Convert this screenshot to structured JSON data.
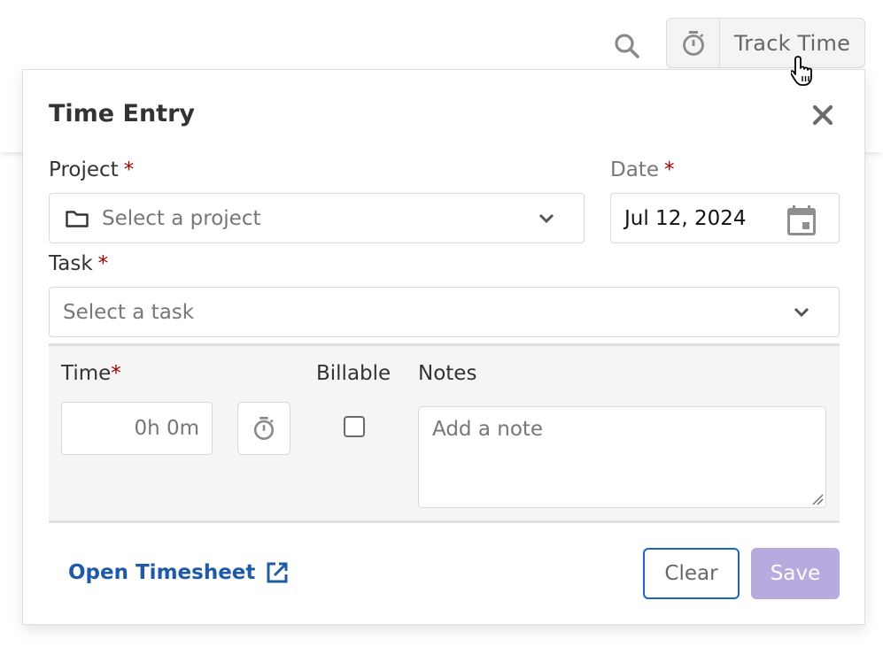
{
  "header": {
    "search_icon": "search-icon",
    "track_time": {
      "icon": "stopwatch-icon",
      "label": "Track Time"
    }
  },
  "popover": {
    "title": "Time Entry",
    "close_icon": "close-icon",
    "project": {
      "label": "Project",
      "required_mark": "*",
      "icon": "folder-icon",
      "placeholder": "Select a project",
      "dropdown_icon": "chevron-down-icon"
    },
    "date": {
      "label": "Date",
      "required_mark": "*",
      "value": "Jul 12, 2024",
      "icon": "calendar-icon"
    },
    "task": {
      "label": "Task",
      "required_mark": "*",
      "placeholder": "Select a task",
      "dropdown_icon": "chevron-down-icon"
    },
    "time": {
      "label": "Time",
      "required_mark": "*",
      "placeholder": "0h 0m",
      "timer_icon": "stopwatch-icon"
    },
    "billable": {
      "label": "Billable",
      "checked": false
    },
    "notes": {
      "label": "Notes",
      "placeholder": "Add a note"
    },
    "footer": {
      "open_timesheet_label": "Open Timesheet",
      "open_timesheet_icon": "external-link-icon",
      "clear_label": "Clear",
      "save_label": "Save"
    }
  },
  "colors": {
    "required": "#a00000",
    "link": "#1f5aa6",
    "focus_border": "#1a63c9",
    "save_disabled": "#b6aadf"
  }
}
